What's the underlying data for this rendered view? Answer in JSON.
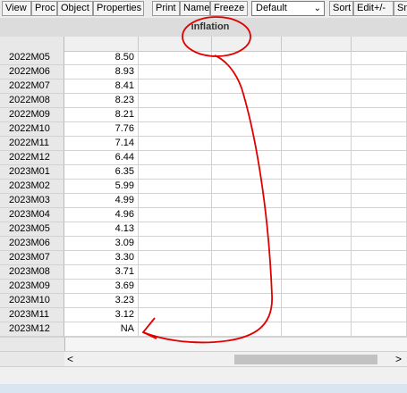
{
  "toolbar": {
    "buttons": [
      "View",
      "Proc",
      "Object",
      "Properties",
      "Print",
      "Name",
      "Freeze"
    ],
    "combo_value": "Default",
    "right_buttons": [
      "Sort",
      "Edit+/-",
      "Sm"
    ]
  },
  "series": {
    "name": "inflation"
  },
  "rows": [
    {
      "date": "2022M05",
      "value": "8.50"
    },
    {
      "date": "2022M06",
      "value": "8.93"
    },
    {
      "date": "2022M07",
      "value": "8.41"
    },
    {
      "date": "2022M08",
      "value": "8.23"
    },
    {
      "date": "2022M09",
      "value": "8.21"
    },
    {
      "date": "2022M10",
      "value": "7.76"
    },
    {
      "date": "2022M11",
      "value": "7.14"
    },
    {
      "date": "2022M12",
      "value": "6.44"
    },
    {
      "date": "2023M01",
      "value": "6.35"
    },
    {
      "date": "2023M02",
      "value": "5.99"
    },
    {
      "date": "2023M03",
      "value": "4.99"
    },
    {
      "date": "2023M04",
      "value": "4.96"
    },
    {
      "date": "2023M05",
      "value": "4.13"
    },
    {
      "date": "2023M06",
      "value": "3.09"
    },
    {
      "date": "2023M07",
      "value": "3.30"
    },
    {
      "date": "2023M08",
      "value": "3.71"
    },
    {
      "date": "2023M09",
      "value": "3.69"
    },
    {
      "date": "2023M10",
      "value": "3.23"
    },
    {
      "date": "2023M11",
      "value": "3.12"
    },
    {
      "date": "2023M12",
      "value": "NA"
    }
  ],
  "scroll": {
    "left_arrow": "<",
    "right_arrow": ">"
  },
  "combo_arrow": "⌄",
  "annotation_color": "#e00000"
}
